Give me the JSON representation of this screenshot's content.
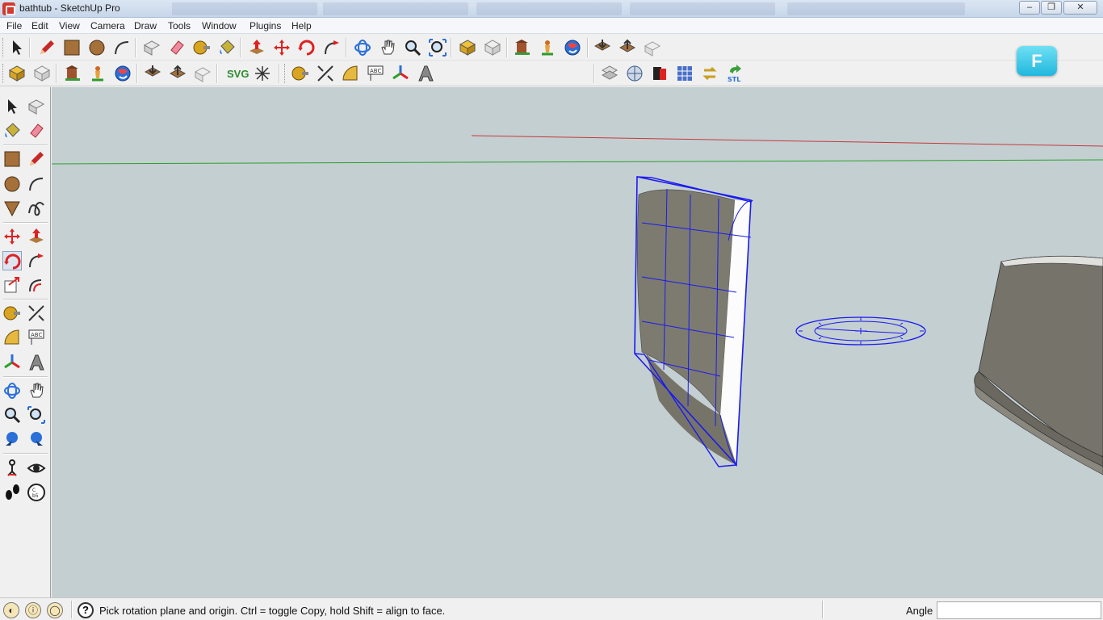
{
  "window": {
    "title": "bathtub - SketchUp Pro",
    "minimize": "–",
    "maximize": "❐",
    "close": "✕"
  },
  "menu": [
    "File",
    "Edit",
    "View",
    "Camera",
    "Draw",
    "Tools",
    "Window",
    "Plugins",
    "Help"
  ],
  "toolbar2": {
    "svg_label": "SVG"
  },
  "badge": {
    "letter": "F",
    "color": "#2ab9dd"
  },
  "status": {
    "message": "Pick rotation plane and origin.  Ctrl = toggle Copy, hold Shift = align to face.",
    "help_glyph": "?",
    "vcb_label": "Angle",
    "vcb_value": ""
  },
  "colors": {
    "viewport_bg": "#c4cfd2",
    "selection": "#1a1aee",
    "red_axis": "#c43a3a",
    "green_axis": "#2aa02a",
    "model_face": "#7d7b70"
  },
  "icons": {
    "toolbar1": [
      "select-icon",
      "pencil-icon",
      "rectangle-icon",
      "circle-icon",
      "arc-icon",
      "make-component-icon",
      "eraser-icon",
      "tape-measure-icon",
      "paint-bucket-icon",
      "push-pull-icon",
      "move-icon",
      "rotate-icon",
      "follow-me-icon",
      "orbit-icon",
      "pan-icon",
      "zoom-icon",
      "zoom-extents-icon",
      "get-models-icon",
      "share-model-icon",
      "3d-warehouse-icon",
      "google-earth-icon",
      "geo-location-icon",
      "export-icon",
      "import-icon",
      "share-component-icon"
    ],
    "toolbar2": [
      "get-models-icon",
      "share-model-icon",
      "building-icon",
      "geolocate-icon",
      "globe-icon",
      "download-icon",
      "upload-icon",
      "component-icon",
      "svg-export-icon",
      "plugin-icon",
      "tape-measure-icon",
      "dimension-icon",
      "protractor-icon",
      "text-icon",
      "axes-icon",
      "3d-text-icon",
      "section-plane-icon",
      "sandbox-icon",
      "solid-tools-icon",
      "texture-icon",
      "export-stl-icon"
    ]
  }
}
